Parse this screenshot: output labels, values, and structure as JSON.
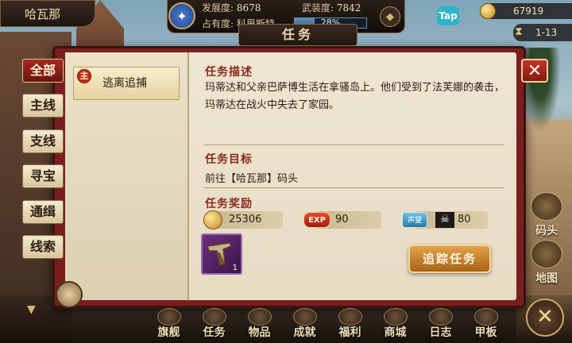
{
  "header": {
    "city": "哈瓦那",
    "development_label": "发展度:",
    "development_value": "8678",
    "armament_label": "武装度:",
    "armament_value": "7842",
    "occupation_label": "占有度: 科里斯特",
    "occupation_percent": "28%",
    "occupation_fraction": 0.28,
    "tap_label": "Tap",
    "gold": "67919",
    "date": "1-13"
  },
  "dialog": {
    "title": "任务",
    "close_label": "✕",
    "categories": [
      {
        "label": "全部",
        "active": true
      },
      {
        "label": "主线",
        "active": false
      },
      {
        "label": "支线",
        "active": false
      },
      {
        "label": "寻宝",
        "active": false
      },
      {
        "label": "通缉",
        "active": false
      },
      {
        "label": "线索",
        "active": false
      }
    ],
    "quest_list": [
      {
        "badge": "主",
        "name": "逃离追捕"
      }
    ],
    "description_title": "任务描述",
    "description_text": "玛蒂达和父亲巴萨博生活在拿骚岛上。他们受到了法芙娜的袭击，玛蒂达在战火中失去了家园。",
    "objective_title": "任务目标",
    "objective_text": "前往【哈瓦那】码头",
    "reward_title": "任务奖励",
    "rewards": {
      "gold": "25306",
      "exp_label": "EXP",
      "exp": "90",
      "fame_label": "声望",
      "fame": "80"
    },
    "reward_item_qty": "1",
    "track_button": "追踪任务"
  },
  "side_buttons": [
    {
      "label": "码头",
      "icon": "dock-icon"
    },
    {
      "label": "地图",
      "icon": "map-icon"
    }
  ],
  "bottom_nav": [
    {
      "label": "旗舰",
      "icon": "ship-wheel-icon"
    },
    {
      "label": "任务",
      "icon": "quest-icon"
    },
    {
      "label": "物品",
      "icon": "bag-icon"
    },
    {
      "label": "成就",
      "icon": "trophy-icon"
    },
    {
      "label": "福利",
      "icon": "gift-icon"
    },
    {
      "label": "商城",
      "icon": "shop-icon"
    },
    {
      "label": "日志",
      "icon": "log-icon"
    },
    {
      "label": "甲板",
      "icon": "deck-icon"
    }
  ]
}
